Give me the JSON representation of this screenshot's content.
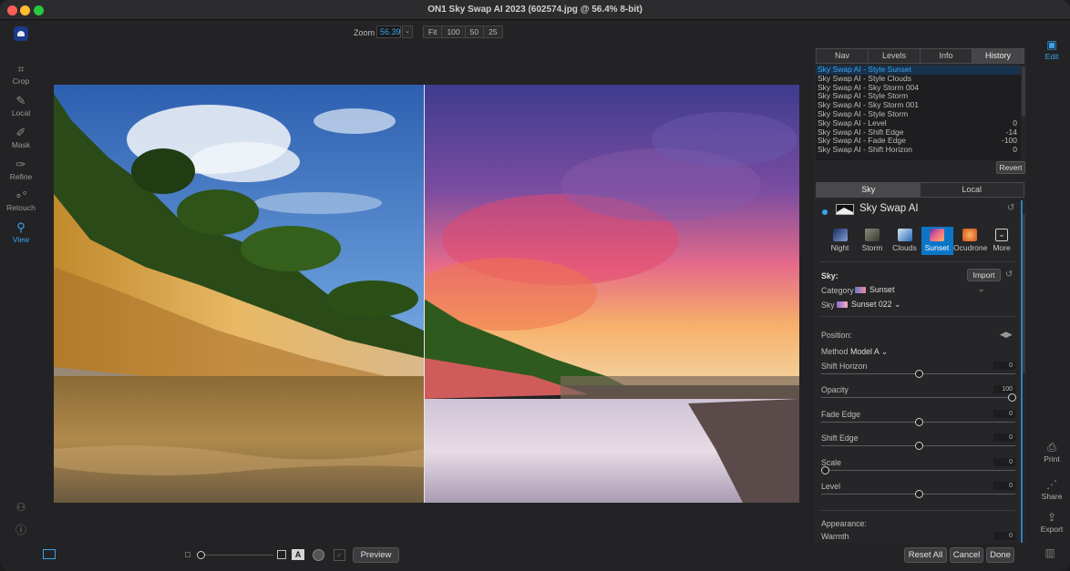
{
  "window": {
    "title": "ON1 Sky Swap AI 2023 (602574.jpg @ 56.4% 8-bit)"
  },
  "left_tools": [
    {
      "label": "Crop",
      "icon": "crop-icon"
    },
    {
      "label": "Local",
      "icon": "brush-icon"
    },
    {
      "label": "Mask",
      "icon": "mask-brush-icon"
    },
    {
      "label": "Refine",
      "icon": "refine-brush-icon"
    },
    {
      "label": "Retouch",
      "icon": "retouch-icon"
    },
    {
      "label": "View",
      "icon": "zoom-icon"
    }
  ],
  "zoom": {
    "label": "Zoom",
    "value": "56.39",
    "buttons": [
      "Fit",
      "100",
      "50",
      "25"
    ]
  },
  "panel_tabs": [
    "Nav",
    "Levels",
    "Info",
    "History"
  ],
  "history": [
    {
      "label": "Sky Swap AI - Style Sunset",
      "value": ""
    },
    {
      "label": "Sky Swap AI - Style Clouds",
      "value": ""
    },
    {
      "label": "Sky Swap AI - Sky Storm 004",
      "value": ""
    },
    {
      "label": "Sky Swap AI - Style Storm",
      "value": ""
    },
    {
      "label": "Sky Swap AI - Sky Storm 001",
      "value": ""
    },
    {
      "label": "Sky Swap AI - Style Storm",
      "value": ""
    },
    {
      "label": "Sky Swap AI - Level",
      "value": "0"
    },
    {
      "label": "Sky Swap AI - Shift Edge",
      "value": "-14"
    },
    {
      "label": "Sky Swap AI - Fade Edge",
      "value": "-100"
    },
    {
      "label": "Sky Swap AI - Shift Horizon",
      "value": "0"
    }
  ],
  "revert_label": "Revert",
  "sky_local_tabs": [
    "Sky",
    "Local"
  ],
  "module": {
    "title": "Sky Swap AI",
    "styles": [
      "Night",
      "Storm",
      "Clouds",
      "Sunset",
      "Ocudrone",
      "More"
    ],
    "sky_heading": "Sky:",
    "import_label": "Import",
    "category_label": "Category",
    "category_value": "Sunset",
    "sky_label": "Sky",
    "sky_value": "Sunset 022",
    "position_heading": "Position:",
    "method_label": "Method",
    "method_value": "Model A",
    "sliders": [
      {
        "name": "Shift Horizon",
        "value": "0",
        "level": 0.5
      },
      {
        "name": "Opacity",
        "value": "100",
        "level": 1.0
      },
      {
        "name": "Fade Edge",
        "value": "0",
        "level": 0.5
      },
      {
        "name": "Shift Edge",
        "value": "0",
        "level": 0.5
      },
      {
        "name": "Scale",
        "value": "0",
        "level": 0.0
      },
      {
        "name": "Level",
        "value": "0",
        "level": 0.5
      }
    ],
    "appearance_heading": "Appearance:",
    "warmth_label": "Warmth",
    "warmth_value": "0"
  },
  "right_tools": [
    {
      "label": "Edit",
      "icon": "image-icon"
    },
    {
      "label": "Print",
      "icon": "printer-icon"
    },
    {
      "label": "Share",
      "icon": "share-icon"
    },
    {
      "label": "Export",
      "icon": "export-icon"
    }
  ],
  "bottom": {
    "preview_label": "Preview",
    "reset_all_label": "Reset All",
    "cancel_label": "Cancel",
    "done_label": "Done"
  },
  "colors": {
    "accent": "#3aa3ee",
    "selected_style": "#0b76c8"
  }
}
